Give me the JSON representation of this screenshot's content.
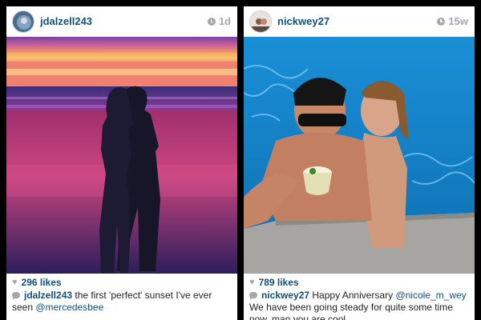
{
  "posts": [
    {
      "username": "jdalzell243",
      "age": "1d",
      "likes": "296 likes",
      "caption_user": "jdalzell243",
      "caption_text": " the first 'perfect' sunset I've ever seen ",
      "caption_mention": "@mercedesbee",
      "caption_after": ""
    },
    {
      "username": "nickwey27",
      "age": "15w",
      "likes": "789 likes",
      "caption_user": "nickwey27",
      "caption_text": " Happy Anniversary ",
      "caption_mention": "@nicole_m_wey",
      "caption_after": " We have been going steady for quite some time now, man you are cool"
    }
  ],
  "colors": {
    "link": "#12507b",
    "muted": "#a8a8a8",
    "background": "#000000",
    "card": "#ffffff"
  },
  "icons": [
    "clock-icon",
    "heart-icon",
    "comment-icon"
  ]
}
